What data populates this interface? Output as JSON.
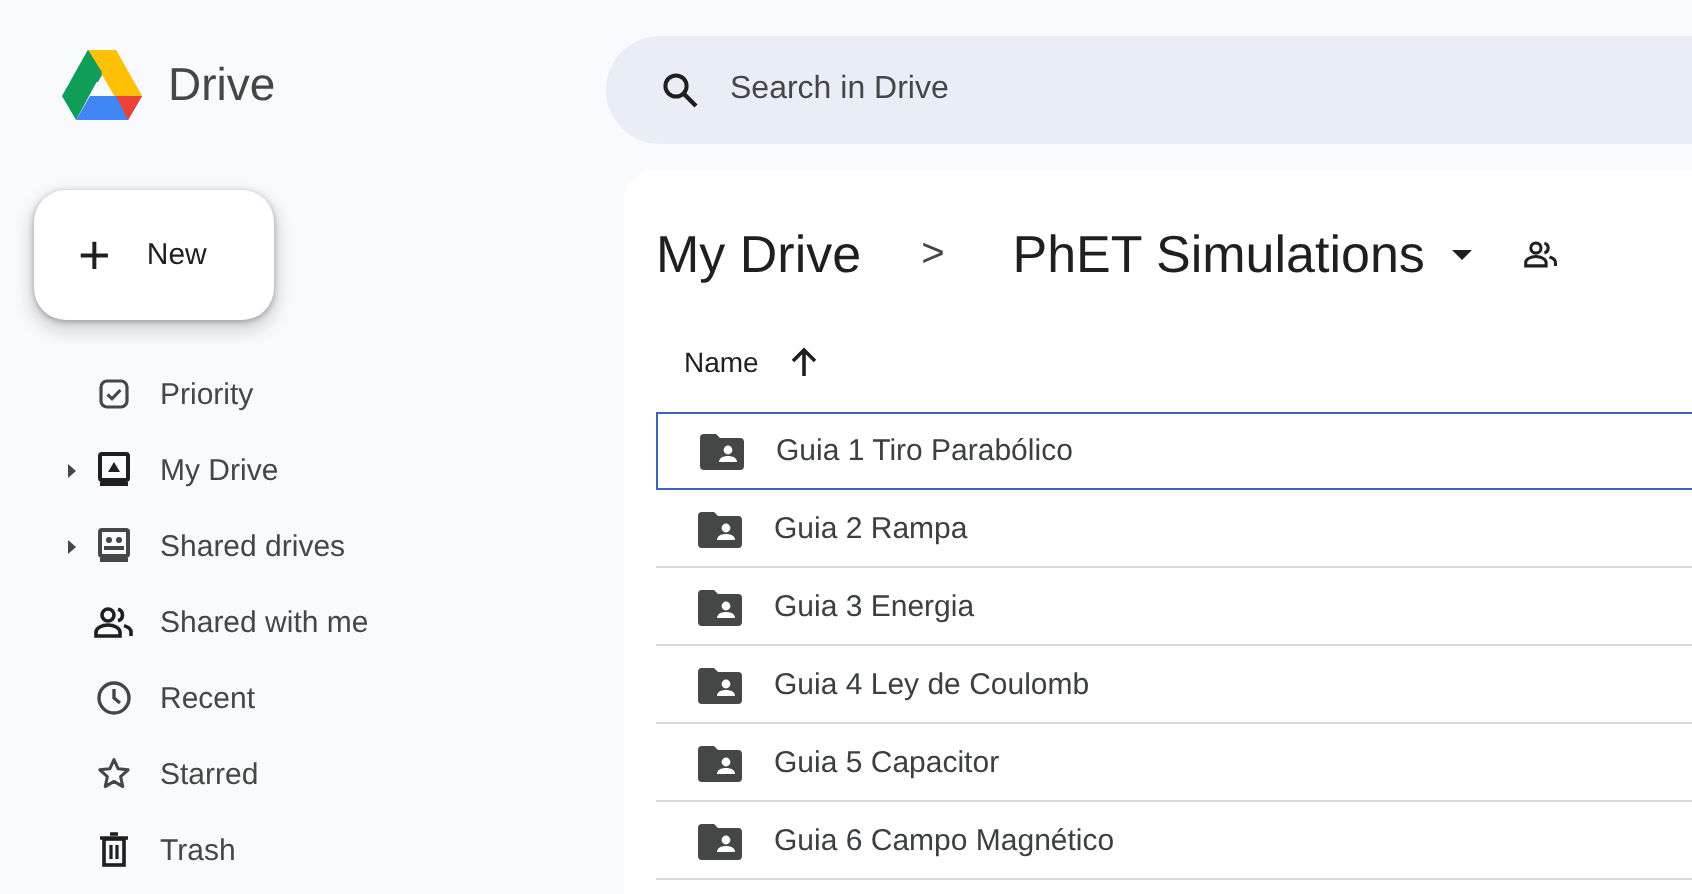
{
  "app": {
    "name": "Drive"
  },
  "search": {
    "placeholder": "Search in Drive"
  },
  "new_button": {
    "label": "New",
    "icon": "+"
  },
  "sidebar": {
    "items": [
      {
        "label": "Priority",
        "expandable": false
      },
      {
        "label": "My Drive",
        "expandable": true
      },
      {
        "label": "Shared drives",
        "expandable": true
      },
      {
        "label": "Shared with me",
        "expandable": false
      },
      {
        "label": "Recent",
        "expandable": false
      },
      {
        "label": "Starred",
        "expandable": false
      },
      {
        "label": "Trash",
        "expandable": false
      }
    ]
  },
  "breadcrumb": {
    "items": [
      "My Drive",
      "PhET Simulations"
    ],
    "separator": ">"
  },
  "table": {
    "columns": [
      {
        "label": "Name",
        "sort_ascending": true
      }
    ],
    "rows": [
      {
        "name": "Guia 1 Tiro Parabólico",
        "selected": true
      },
      {
        "name": "Guia 2 Rampa",
        "selected": false
      },
      {
        "name": "Guia 3 Energia",
        "selected": false
      },
      {
        "name": "Guia 4 Ley de Coulomb",
        "selected": false
      },
      {
        "name": "Guia 5 Capacitor",
        "selected": false
      },
      {
        "name": "Guia 6 Campo Magnético",
        "selected": false
      }
    ]
  }
}
